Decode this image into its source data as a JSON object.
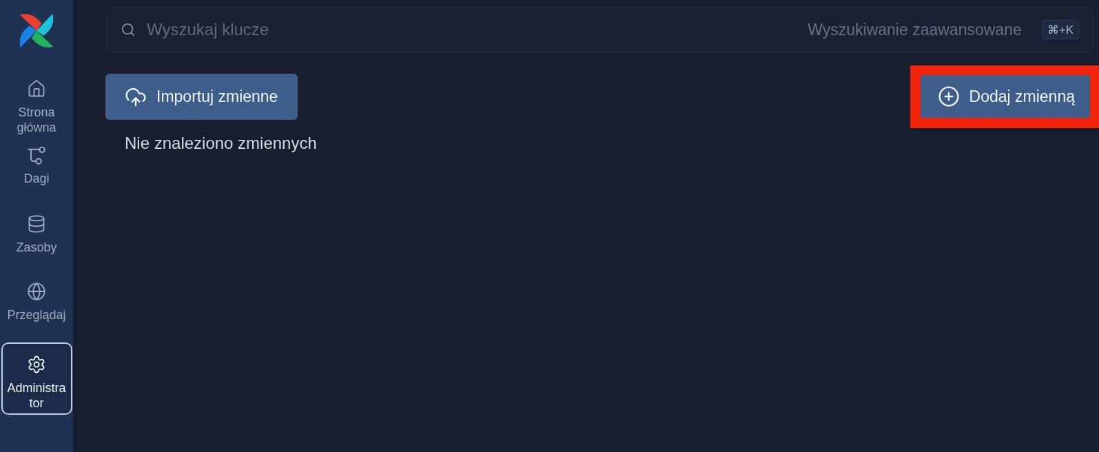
{
  "sidebar": {
    "items": [
      {
        "label": "Strona główna",
        "selected": false
      },
      {
        "label": "Dagi",
        "selected": false
      },
      {
        "label": "Zasoby",
        "selected": false
      },
      {
        "label": "Przeglądaj",
        "selected": false
      },
      {
        "label": "Administrator",
        "selected": true
      }
    ]
  },
  "search": {
    "placeholder": "Wyszukaj klucze",
    "advanced_label": "Wyszukiwanie zaawansowane",
    "shortcut": "⌘+K"
  },
  "toolbar": {
    "import_button": "Importuj zmienne",
    "add_button": {
      "label": "Dodaj zmienną",
      "highlighted": true
    }
  },
  "empty_message": "Nie znaleziono zmiennych"
}
